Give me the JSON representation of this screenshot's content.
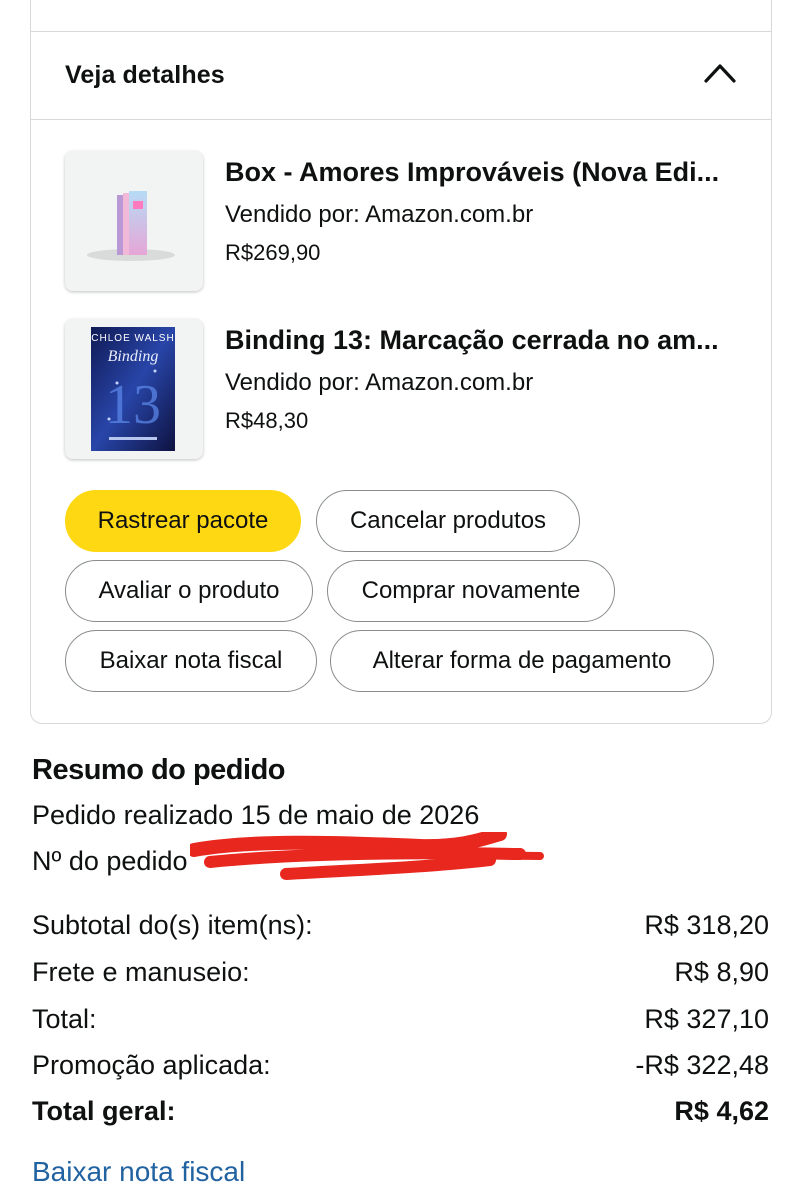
{
  "details": {
    "title": "Veja detalhes",
    "toggle_icon": "chevron-up-icon"
  },
  "items": [
    {
      "title": "Box - Amores Improváveis (Nova Edi...",
      "seller": "Vendido por: Amazon.com.br",
      "price": "R$269,90",
      "cover_text": "",
      "cover_color": "#a7d3ef"
    },
    {
      "title": "Binding 13: Marcação cerrada no am...",
      "seller": "Vendido por: Amazon.com.br",
      "price": "R$48,30",
      "cover_author": "CHLOE WALSH",
      "cover_title": "Binding",
      "cover_number": "13",
      "cover_color": "#1b2a6b"
    }
  ],
  "actions": {
    "track": "Rastrear pacote",
    "cancel": "Cancelar produtos",
    "review": "Avaliar o produto",
    "buy_again": "Comprar novamente",
    "invoice": "Baixar nota fiscal",
    "change_payment": "Alterar forma de pagamento"
  },
  "summary": {
    "title": "Resumo do pedido",
    "order_date": "Pedido realizado 15 de maio de 2026",
    "order_number_label": "Nº do pedido",
    "rows": [
      {
        "label": "Subtotal do(s) item(ns):",
        "value": "R$ 318,20"
      },
      {
        "label": "Frete e manuseio:",
        "value": "R$ 8,90"
      },
      {
        "label": "Total:",
        "value": "R$ 327,10"
      },
      {
        "label": "Promoção aplicada:",
        "value": "-R$ 322,48"
      },
      {
        "label": "Total geral:",
        "value": "R$ 4,62"
      }
    ],
    "download_link": "Baixar nota fiscal"
  },
  "colors": {
    "primary_button": "#ffd814",
    "link": "#2162a1",
    "redaction": "#e8271e"
  }
}
